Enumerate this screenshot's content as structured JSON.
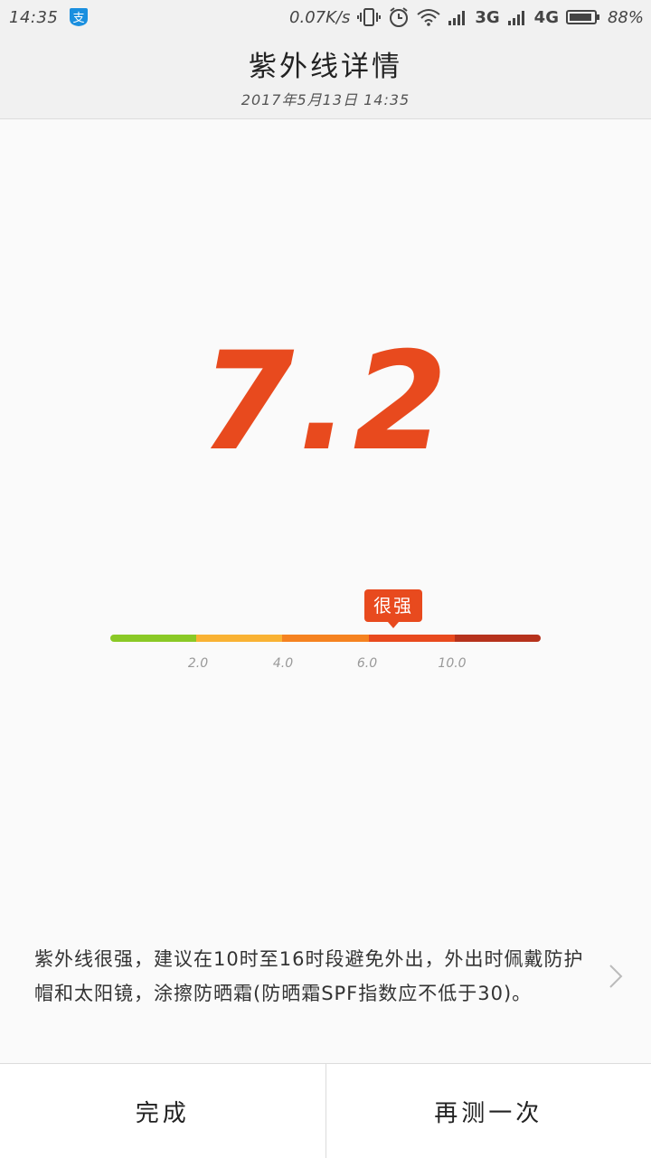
{
  "status_bar": {
    "time": "14:35",
    "net_speed": "0.07K/s",
    "network_3g": "3G",
    "network_4g": "4G",
    "battery_percent": "88%",
    "icons": [
      "alipay-icon",
      "vibrate-icon",
      "alarm-icon",
      "wifi-icon",
      "signal-icon",
      "battery-icon"
    ]
  },
  "header": {
    "title": "紫外线详情",
    "datetime": "2017年5月13日 14:35"
  },
  "reading": {
    "value": "7.2",
    "level_label": "很强"
  },
  "scale": {
    "segment_colors": [
      "#8ac926",
      "#f9b233",
      "#f58220",
      "#e84a1e",
      "#b6321c"
    ],
    "ticks": [
      "2.0",
      "4.0",
      "6.0",
      "10.0"
    ]
  },
  "advice": {
    "text": "紫外线很强，建议在10时至16时段避免外出，外出时佩戴防护帽和太阳镜，涂擦防晒霜(防晒霜SPF指数应不低于30)。"
  },
  "buttons": {
    "done": "完成",
    "retest": "再测一次"
  }
}
